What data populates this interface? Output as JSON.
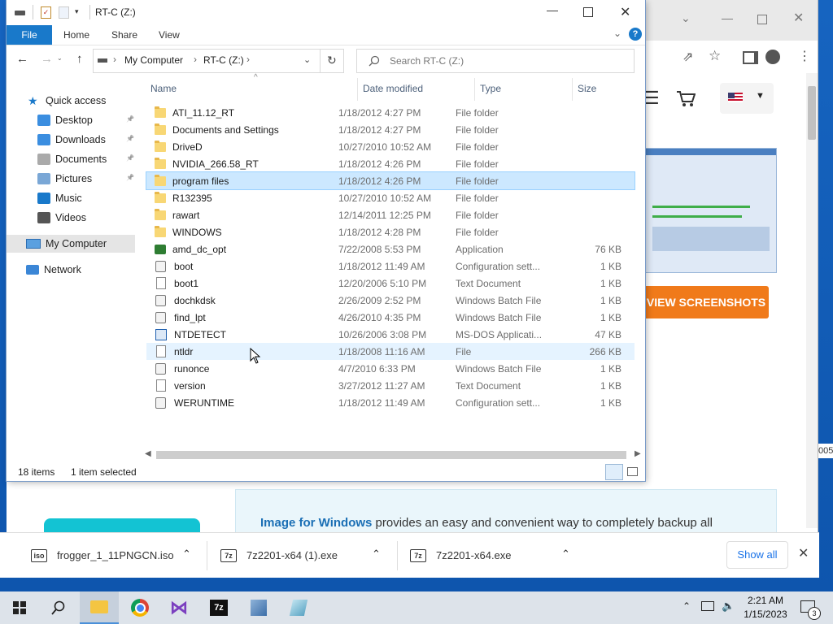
{
  "explorer": {
    "title": "RT-C (Z:)",
    "ribbon_tabs": [
      "File",
      "Home",
      "Share",
      "View"
    ],
    "nav_buttons": {
      "back": "←",
      "forward": "→",
      "up": "↑"
    },
    "address": {
      "root": "My Computer",
      "current": "RT-C (Z:)"
    },
    "search_placeholder": "Search RT-C (Z:)",
    "columns": [
      "Name",
      "Date modified",
      "Type",
      "Size"
    ],
    "nav_pane": {
      "quick_access": "Quick access",
      "quick_items": [
        {
          "label": "Desktop",
          "pinned": true
        },
        {
          "label": "Downloads",
          "pinned": true
        },
        {
          "label": "Documents",
          "pinned": true
        },
        {
          "label": "Pictures",
          "pinned": true
        },
        {
          "label": "Music",
          "pinned": false
        },
        {
          "label": "Videos",
          "pinned": false
        }
      ],
      "my_computer": "My Computer",
      "network": "Network"
    },
    "files": [
      {
        "name": "ATI_11.12_RT",
        "date": "1/18/2012 4:27 PM",
        "type": "File folder",
        "size": "",
        "icon": "folder"
      },
      {
        "name": "Documents and Settings",
        "date": "1/18/2012 4:27 PM",
        "type": "File folder",
        "size": "",
        "icon": "folder"
      },
      {
        "name": "DriveD",
        "date": "10/27/2010 10:52 AM",
        "type": "File folder",
        "size": "",
        "icon": "folder"
      },
      {
        "name": "NVIDIA_266.58_RT",
        "date": "1/18/2012 4:26 PM",
        "type": "File folder",
        "size": "",
        "icon": "folder"
      },
      {
        "name": "program files",
        "date": "1/18/2012 4:26 PM",
        "type": "File folder",
        "size": "",
        "icon": "folder",
        "state": "selected"
      },
      {
        "name": "R132395",
        "date": "10/27/2010 10:52 AM",
        "type": "File folder",
        "size": "",
        "icon": "folder"
      },
      {
        "name": "rawart",
        "date": "12/14/2011 12:25 PM",
        "type": "File folder",
        "size": "",
        "icon": "folder"
      },
      {
        "name": "WINDOWS",
        "date": "1/18/2012 4:28 PM",
        "type": "File folder",
        "size": "",
        "icon": "folder"
      },
      {
        "name": "amd_dc_opt",
        "date": "7/22/2008 5:53 PM",
        "type": "Application",
        "size": "76 KB",
        "icon": "app"
      },
      {
        "name": "boot",
        "date": "1/18/2012 11:49 AM",
        "type": "Configuration sett...",
        "size": "1 KB",
        "icon": "bat"
      },
      {
        "name": "boot1",
        "date": "12/20/2006 5:10 PM",
        "type": "Text Document",
        "size": "1 KB",
        "icon": "doc"
      },
      {
        "name": "dochkdsk",
        "date": "2/26/2009 2:52 PM",
        "type": "Windows Batch File",
        "size": "1 KB",
        "icon": "bat"
      },
      {
        "name": "find_lpt",
        "date": "4/26/2010 4:35 PM",
        "type": "Windows Batch File",
        "size": "1 KB",
        "icon": "bat"
      },
      {
        "name": "NTDETECT",
        "date": "10/26/2006 3:08 PM",
        "type": "MS-DOS Applicati...",
        "size": "47 KB",
        "icon": "com"
      },
      {
        "name": "ntldr",
        "date": "1/18/2008 11:16 AM",
        "type": "File",
        "size": "266 KB",
        "icon": "doc",
        "state": "hover"
      },
      {
        "name": "runonce",
        "date": "4/7/2010 6:33 PM",
        "type": "Windows Batch File",
        "size": "1 KB",
        "icon": "bat"
      },
      {
        "name": "version",
        "date": "3/27/2012 11:27 AM",
        "type": "Text Document",
        "size": "1 KB",
        "icon": "doc"
      },
      {
        "name": "WERUNTIME",
        "date": "1/18/2012 11:49 AM",
        "type": "Configuration sett...",
        "size": "1 KB",
        "icon": "bat"
      }
    ],
    "status_count": "18 items",
    "status_selected": "1 item selected"
  },
  "browser": {
    "cta": "VIEW SCREENSHOTS",
    "promo_bold": "Image for Windows",
    "promo_text": " provides an easy and convenient way to completely backup all",
    "partial_right": "005",
    "cta_color": "#f07a1a"
  },
  "downloads": {
    "items": [
      {
        "name": "frogger_1_11PNGCN.iso",
        "icon": "iso"
      },
      {
        "name": "7z2201-x64 (1).exe",
        "icon": "7z"
      },
      {
        "name": "7z2201-x64.exe",
        "icon": "7z"
      }
    ],
    "show_all": "Show all"
  },
  "taskbar": {
    "time": "2:21 AM",
    "date": "1/15/2023",
    "notifications": "3",
    "apps": [
      "start-icon",
      "search-icon",
      "file-explorer-icon",
      "chrome-icon",
      "visual-studio-icon",
      "7zip-icon",
      "app-icon",
      "app2-icon"
    ]
  }
}
